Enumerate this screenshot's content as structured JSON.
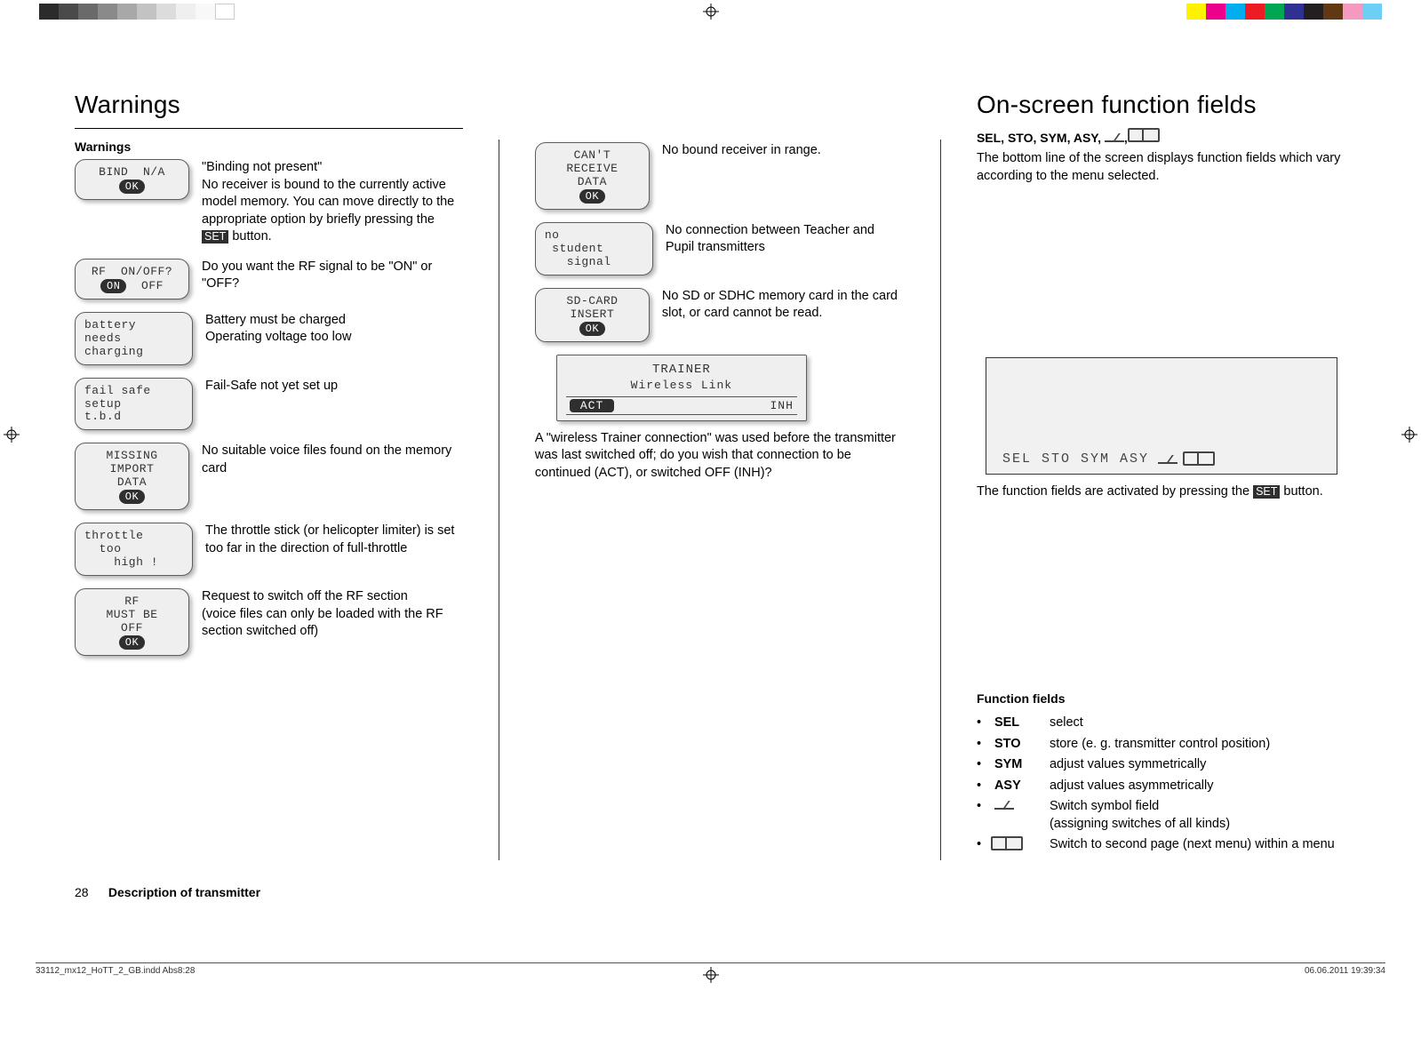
{
  "page": {
    "number": "28",
    "sectionTitle": "Description of transmitter",
    "printFile": "33112_mx12_HoTT_2_GB.indd   Abs8:28",
    "printDate": "06.06.2011   19:39:34"
  },
  "col1": {
    "heading": "Warnings",
    "subheading": "Warnings",
    "items": [
      {
        "box": {
          "lines": [
            "BIND  N/A"
          ],
          "pill": "OK",
          "cls": ""
        },
        "text": "\"Binding not present\"\nNo receiver is bound to the currently active model memory. You can move directly to the appropriate option by briefly pressing the ",
        "set": "SET",
        "textAfter": " button."
      },
      {
        "box": {
          "lines": [
            "RF  ON/OFF?"
          ],
          "pillRow": [
            "ON",
            "OFF"
          ],
          "cls": ""
        },
        "text": "Do you want the RF signal to be \"ON\" or \"OFF?"
      },
      {
        "box": {
          "lines": [
            "battery",
            "needs",
            "charging"
          ],
          "cls": "left"
        },
        "text": "Battery must be charged\nOperating voltage too low"
      },
      {
        "box": {
          "lines": [
            "fail safe",
            "setup",
            "t.b.d"
          ],
          "cls": "left"
        },
        "text": "Fail-Safe not yet set up"
      },
      {
        "box": {
          "lines": [
            "MISSING",
            "IMPORT",
            "DATA"
          ],
          "pill": "OK",
          "cls": ""
        },
        "text": "No suitable voice files found on the memory card"
      },
      {
        "box": {
          "lines": [
            "throttle",
            "  too",
            "    high !"
          ],
          "cls": "left"
        },
        "text": "The throttle stick (or helicopter limiter) is set too far in the direction of full-throttle"
      },
      {
        "box": {
          "lines": [
            "RF",
            "MUST BE",
            "OFF"
          ],
          "pill": "OK",
          "cls": ""
        },
        "text": "Request to switch off the RF section\n(voice files can only be loaded with the RF section switched off)"
      }
    ]
  },
  "col2": {
    "items": [
      {
        "box": {
          "lines": [
            "CAN'T",
            "RECEIVE",
            "DATA"
          ],
          "pill": "OK",
          "cls": ""
        },
        "text": "No bound receiver in range."
      },
      {
        "box": {
          "lines": [
            "no",
            " student",
            "   signal"
          ],
          "cls": "left"
        },
        "text": "No connection between Teacher and Pupil transmitters"
      },
      {
        "box": {
          "lines": [
            "SD-CARD",
            "INSERT"
          ],
          "pill": "OK",
          "cls": ""
        },
        "text": "No SD or SDHC memory card in the card slot, or card cannot be read."
      }
    ],
    "trainer": {
      "title": "TRAINER",
      "sub": "Wireless Link",
      "act": "ACT",
      "inh": "INH"
    },
    "trainerText": "A \"wireless Trainer connection\" was used before the transmitter was last switched off; do you wish that connection to be continued (ACT), or switched OFF (INH)?"
  },
  "col3": {
    "heading": "On-screen function fields",
    "boldline": "SEL, STO, SYM, ASY, ",
    "intro": "The bottom line of the screen displays function fields which vary according to the menu selected.",
    "screenFields": "SEL  STO  SYM  ASY",
    "afterScreen1": "The function fields are activated by pressing the ",
    "afterScreenSet": "SET",
    "afterScreen2": " button.",
    "listTitle": "Function fields",
    "fields": [
      {
        "lbl": "SEL",
        "desc": "select"
      },
      {
        "lbl": "STO",
        "desc": "store (e. g. transmitter control position)"
      },
      {
        "lbl": "SYM",
        "desc": "adjust values symmetrically"
      },
      {
        "lbl": "ASY",
        "desc": "adjust values asymmetrically"
      },
      {
        "lbl": "",
        "icon": "sw",
        "desc": "Switch symbol field\n(assigning switches of all kinds)"
      },
      {
        "lbl": "",
        "icon": "pg",
        "desc": "Switch to second page (next menu) within a menu"
      }
    ]
  }
}
